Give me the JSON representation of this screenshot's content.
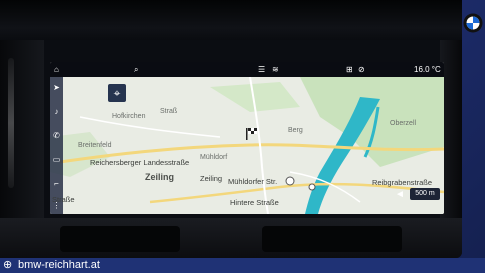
{
  "status_bar": {
    "icons": [
      "home-icon",
      "search-icon",
      "list-icon",
      "layers-icon",
      "tag-icon",
      "mute-icon"
    ],
    "temperature": "16.0 °C"
  },
  "sidebar": {
    "icons": [
      "navigation-icon",
      "music-icon",
      "phone-icon",
      "car-icon",
      "seat-icon",
      "apps-icon"
    ]
  },
  "map": {
    "labels": [
      {
        "text": "Hofkirchen"
      },
      {
        "text": "Straß"
      },
      {
        "text": "Breitenfeld"
      },
      {
        "text": "Zeiling"
      },
      {
        "text": "Berg"
      },
      {
        "text": "Mühldorf"
      },
      {
        "text": "Oberzell"
      }
    ],
    "road_labels": [
      {
        "text": "Reichersberger Landesstraße"
      },
      {
        "text": "Zeiling"
      },
      {
        "text": "Mühldorfer Str."
      },
      {
        "text": "Hintere Straße"
      },
      {
        "text": "Reibgrabenstraße"
      },
      {
        "text": "Straße"
      }
    ],
    "scale": "500 m",
    "colors": {
      "land": "#e9ece4",
      "green": "#c9e2bc",
      "river": "#2fb7c8",
      "road": "#f3d77c"
    }
  },
  "footer": {
    "website": "bmw-reichhart.at",
    "icon": "globe-icon"
  },
  "brand": {
    "logo": "bmw-logo"
  }
}
